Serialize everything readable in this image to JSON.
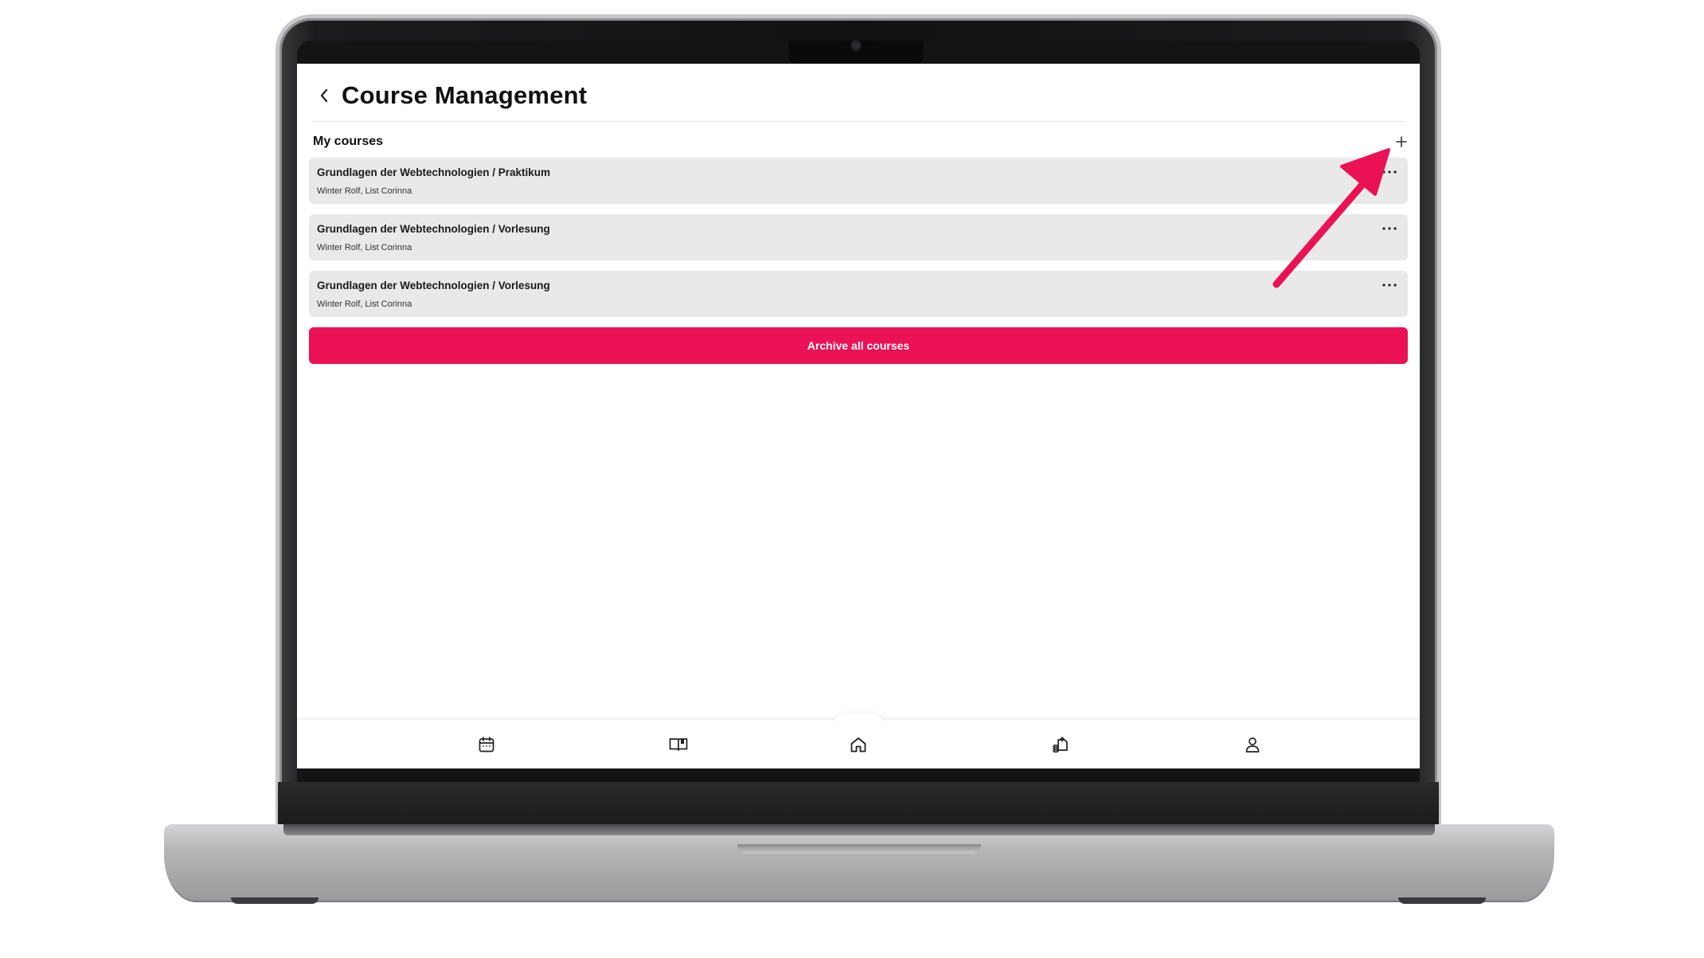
{
  "header": {
    "title": "Course Management",
    "back_icon": "chevron-left-icon"
  },
  "section": {
    "title": "My courses",
    "add_icon": "plus-icon"
  },
  "courses": [
    {
      "title": "Grundlagen der Webtechnologien / Praktikum",
      "people": "Winter Rolf, List Corinna"
    },
    {
      "title": "Grundlagen der Webtechnologien / Vorlesung",
      "people": "Winter Rolf, List Corinna"
    },
    {
      "title": "Grundlagen der Webtechnologien / Vorlesung",
      "people": "Winter Rolf, List Corinna"
    }
  ],
  "archive_button": {
    "label": "Archive all courses",
    "color": "#ea1254"
  },
  "tabbar": {
    "items": [
      {
        "icon": "calendar-icon"
      },
      {
        "icon": "book-icon"
      },
      {
        "icon": "home-icon"
      },
      {
        "icon": "finance-icon"
      },
      {
        "icon": "profile-icon"
      }
    ]
  },
  "annotation": {
    "arrow_color": "#ea1254",
    "icon": "arrow-pointer-icon"
  }
}
